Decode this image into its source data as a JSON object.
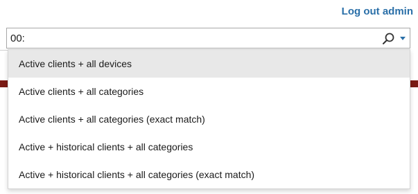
{
  "header": {
    "logout_label": "Log out admin"
  },
  "search": {
    "value": "00:",
    "search_icon": "magnifier-icon",
    "dropdown_icon": "chevron-down-icon"
  },
  "menu": {
    "items": [
      {
        "label": "Active clients + all devices",
        "highlighted": true
      },
      {
        "label": "Active clients + all categories",
        "highlighted": false
      },
      {
        "label": "Active clients + all categories (exact match)",
        "highlighted": false
      },
      {
        "label": "Active + historical clients + all categories",
        "highlighted": false
      },
      {
        "label": "Active + historical clients + all categories (exact match)",
        "highlighted": false
      }
    ]
  },
  "colors": {
    "link": "#2a6fa8",
    "highlight": "#e8e8e8",
    "background_strip": "#7a1a14"
  }
}
